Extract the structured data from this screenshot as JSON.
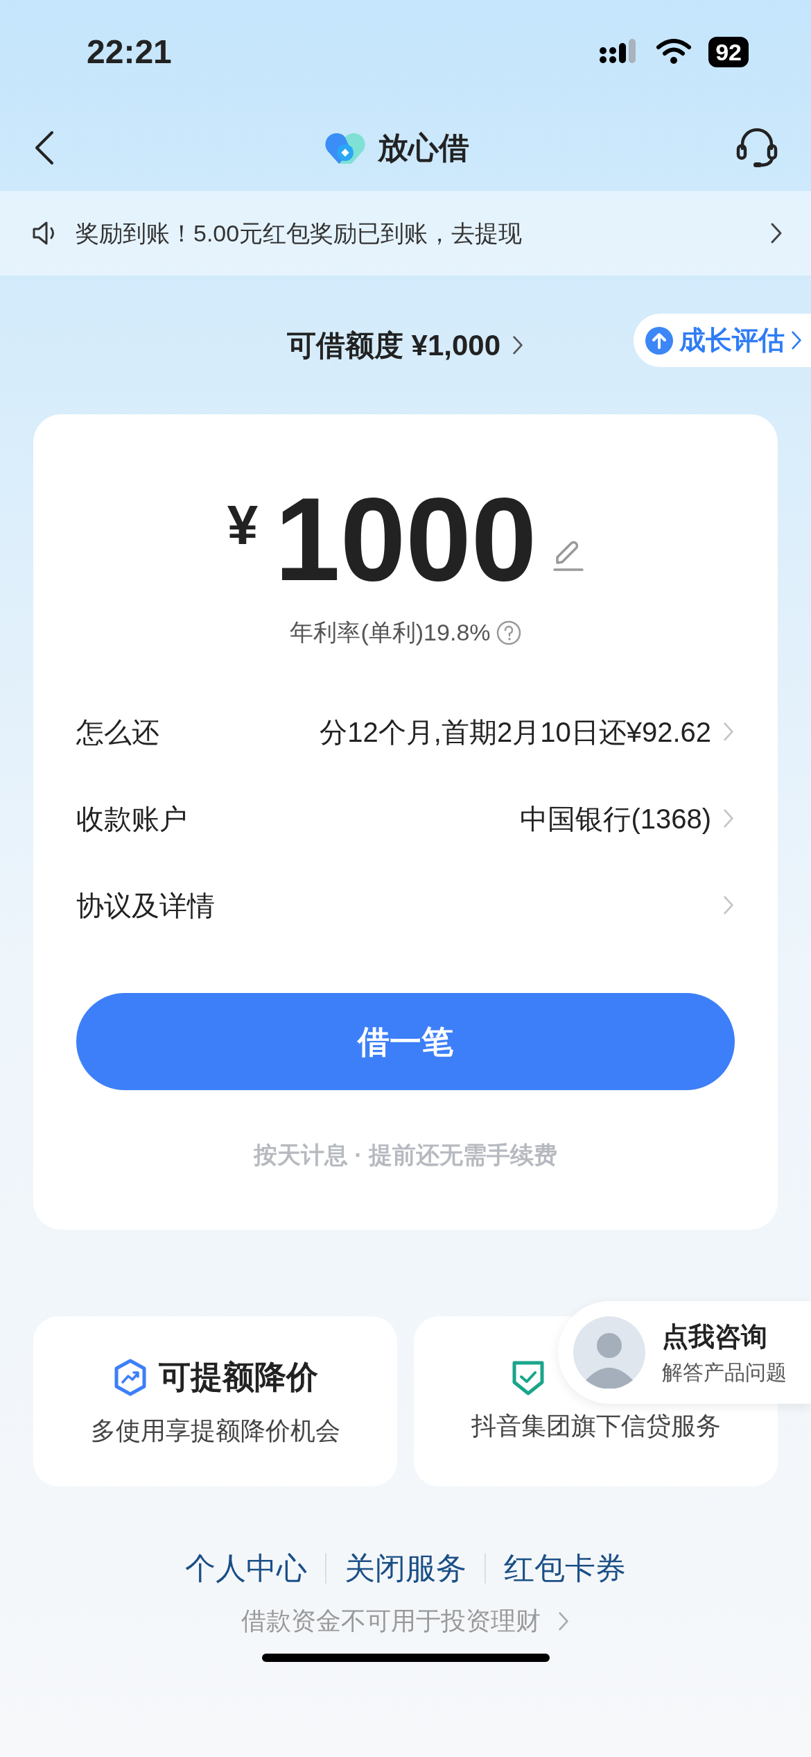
{
  "status_bar": {
    "time": "22:21",
    "battery": "92"
  },
  "nav": {
    "title": "放心借"
  },
  "notice": {
    "text": "奖励到账！5.00元红包奖励已到账，去提现"
  },
  "credit": {
    "label": "可借额度 ¥1,000",
    "badge": "成长评估"
  },
  "loan": {
    "currency": "¥",
    "amount": "1000",
    "rate": "年利率(单利)19.8%",
    "rows": [
      {
        "label": "怎么还",
        "value": "分12个月,首期2月10日还¥92.62"
      },
      {
        "label": "收款账户",
        "value": "中国银行(1368)"
      },
      {
        "label": "协议及详情"
      }
    ],
    "button": "借一笔",
    "note": "按天计息 · 提前还无需手续费"
  },
  "features": [
    {
      "kind": "growth",
      "title": "可提额降价",
      "subtitle": "多使用享提额降价机会"
    },
    {
      "kind": "shield",
      "subtitle": "抖音集团旗下信贷服务"
    }
  ],
  "consult": {
    "title": "点我咨询",
    "subtitle": "解答产品问题"
  },
  "links": [
    "个人中心",
    "关闭服务",
    "红包卡券"
  ],
  "disclaimer": "借款资金不可用于投资理财"
}
